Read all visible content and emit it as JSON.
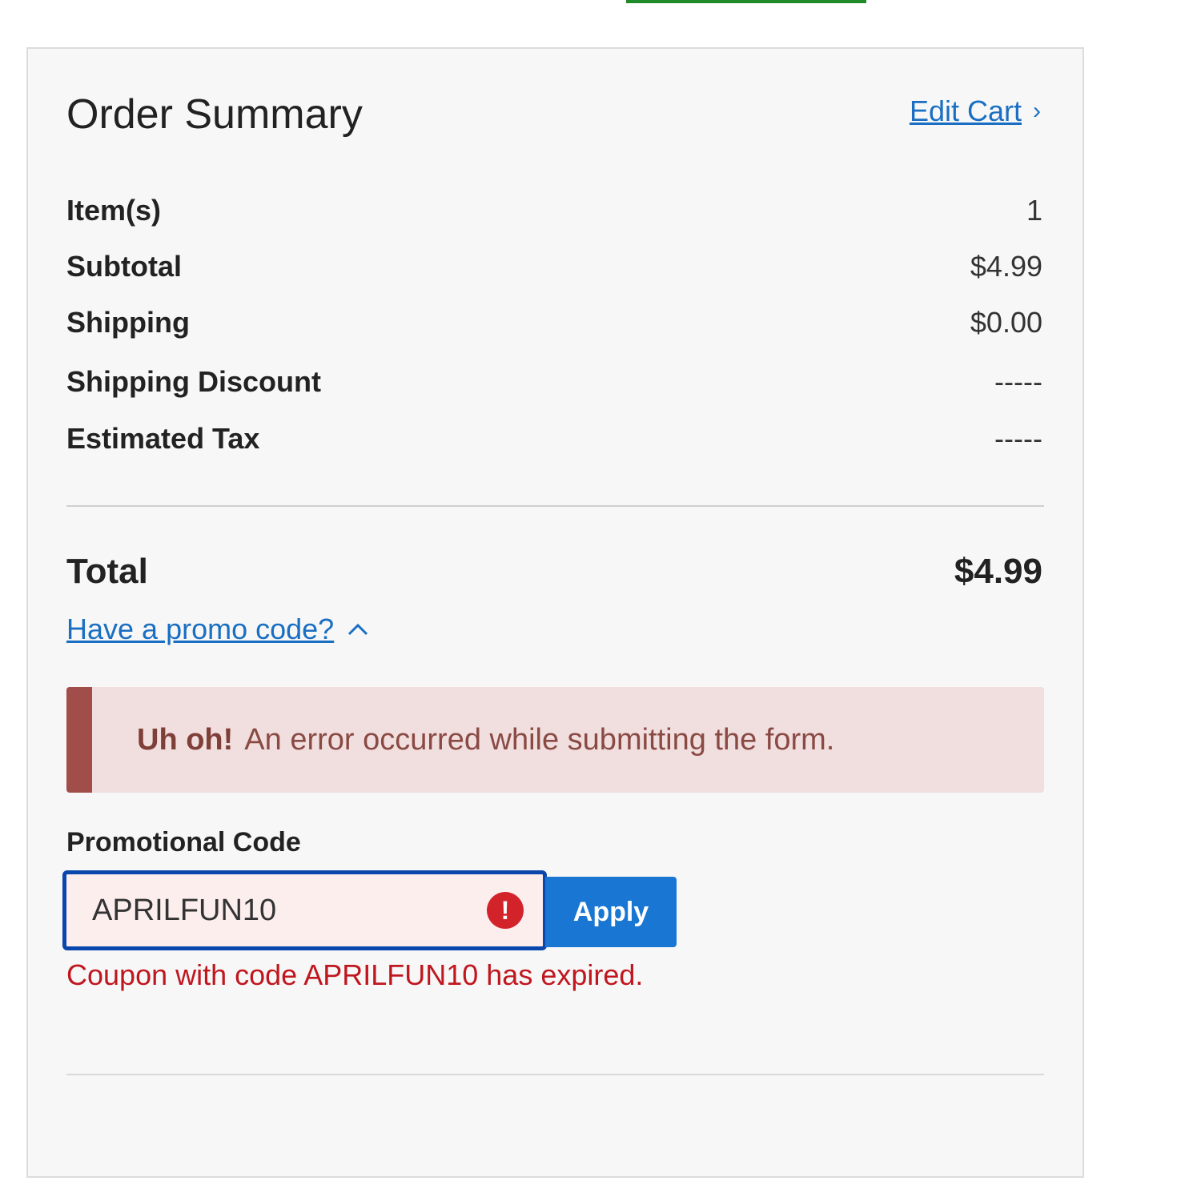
{
  "order_summary": {
    "title": "Order Summary",
    "edit_cart_label": "Edit Cart",
    "rows": [
      {
        "label": "Item(s)",
        "value": "1"
      },
      {
        "label": "Subtotal",
        "value": "$4.99"
      },
      {
        "label": "Shipping",
        "value": "$0.00"
      },
      {
        "label": "Shipping Discount",
        "value": "-----"
      },
      {
        "label": "Estimated Tax",
        "value": "-----"
      }
    ],
    "total": {
      "label": "Total",
      "value": "$4.99"
    },
    "promo_toggle_label": "Have a promo code?"
  },
  "alert": {
    "strong": "Uh oh!",
    "message": "An error occurred while submitting the form."
  },
  "promo_form": {
    "label": "Promotional Code",
    "value": "APRILFUN10",
    "apply_label": "Apply",
    "error_icon": "!",
    "error_message": "Coupon with code APRILFUN10 has expired."
  },
  "colors": {
    "link": "#1a6fc2",
    "accent_green": "#1f8a2a",
    "alert_bar": "#a14e4a",
    "alert_bg": "#f1dede",
    "button": "#1976d2",
    "error": "#c0171f",
    "input_focus": "#0a47ad"
  }
}
